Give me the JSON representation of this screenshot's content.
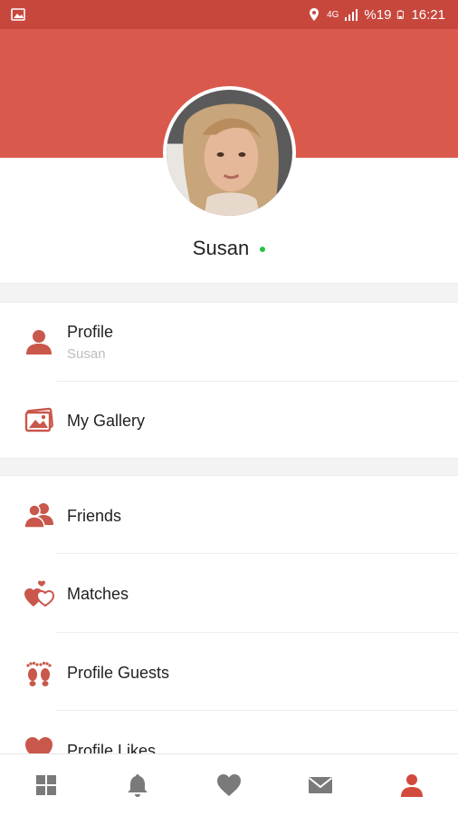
{
  "status_bar": {
    "network_label": "4G",
    "battery_percent": "%19",
    "time": "16:21"
  },
  "profile": {
    "name": "Susan",
    "online": true
  },
  "menu": {
    "items": [
      {
        "label": "Profile",
        "sublabel": "Susan",
        "icon": "person-icon"
      },
      {
        "label": "My Gallery",
        "icon": "gallery-icon"
      },
      {
        "label": "Friends",
        "icon": "friends-icon"
      },
      {
        "label": "Matches",
        "icon": "matches-hearts-icon"
      },
      {
        "label": "Profile Guests",
        "icon": "footprints-icon"
      },
      {
        "label": "Profile Likes",
        "icon": "heart-icon"
      }
    ]
  },
  "bottom_nav": {
    "items": [
      {
        "name": "grid-icon"
      },
      {
        "name": "bell-icon"
      },
      {
        "name": "heart-icon"
      },
      {
        "name": "mail-icon"
      },
      {
        "name": "profile-icon",
        "active": true
      }
    ]
  },
  "colors": {
    "status_bar": "#c8473c",
    "header": "#d9594c",
    "accent": "#c9574b",
    "online": "#25c244",
    "nav_inactive": "#7a7a7a"
  }
}
